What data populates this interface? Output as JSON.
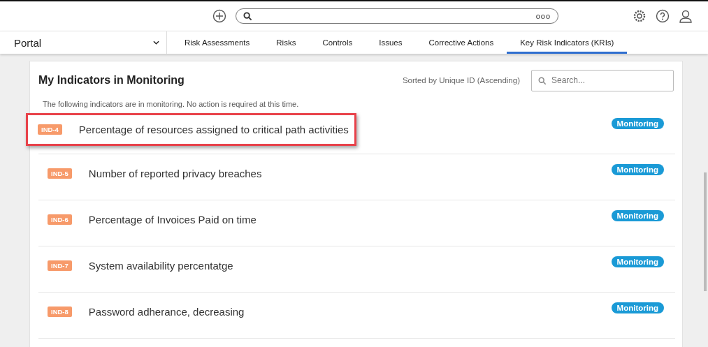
{
  "nav": {
    "portal": "Portal",
    "more": "ooo"
  },
  "tabs": [
    {
      "label": "Risk Assessments",
      "selected": false
    },
    {
      "label": "Risks",
      "selected": false
    },
    {
      "label": "Controls",
      "selected": false
    },
    {
      "label": "Issues",
      "selected": false
    },
    {
      "label": "Corrective Actions",
      "selected": false
    },
    {
      "label": "Key Risk Indicators (KRIs)",
      "selected": true
    }
  ],
  "panel": {
    "title": "My Indicators in Monitoring",
    "sort": "Sorted by Unique ID (Ascending)",
    "search": {
      "placeholder": "Search..."
    },
    "note": "The following indicators are in monitoring. No action is required at this time."
  },
  "indicators": [
    {
      "id": "IND-4",
      "name": "Percentage of resources assigned to critical path activities",
      "status": "Monitoring",
      "highlighted": true
    },
    {
      "id": "IND-5",
      "name": "Number of reported privacy breaches",
      "status": "Monitoring",
      "highlighted": false
    },
    {
      "id": "IND-6",
      "name": "Percentage of Invoices Paid on time",
      "status": "Monitoring",
      "highlighted": false
    },
    {
      "id": "IND-7",
      "name": "System availability percentatge",
      "status": "Monitoring",
      "highlighted": false
    },
    {
      "id": "IND-8",
      "name": "Password adherance, decreasing",
      "status": "Monitoring",
      "highlighted": false
    }
  ]
}
